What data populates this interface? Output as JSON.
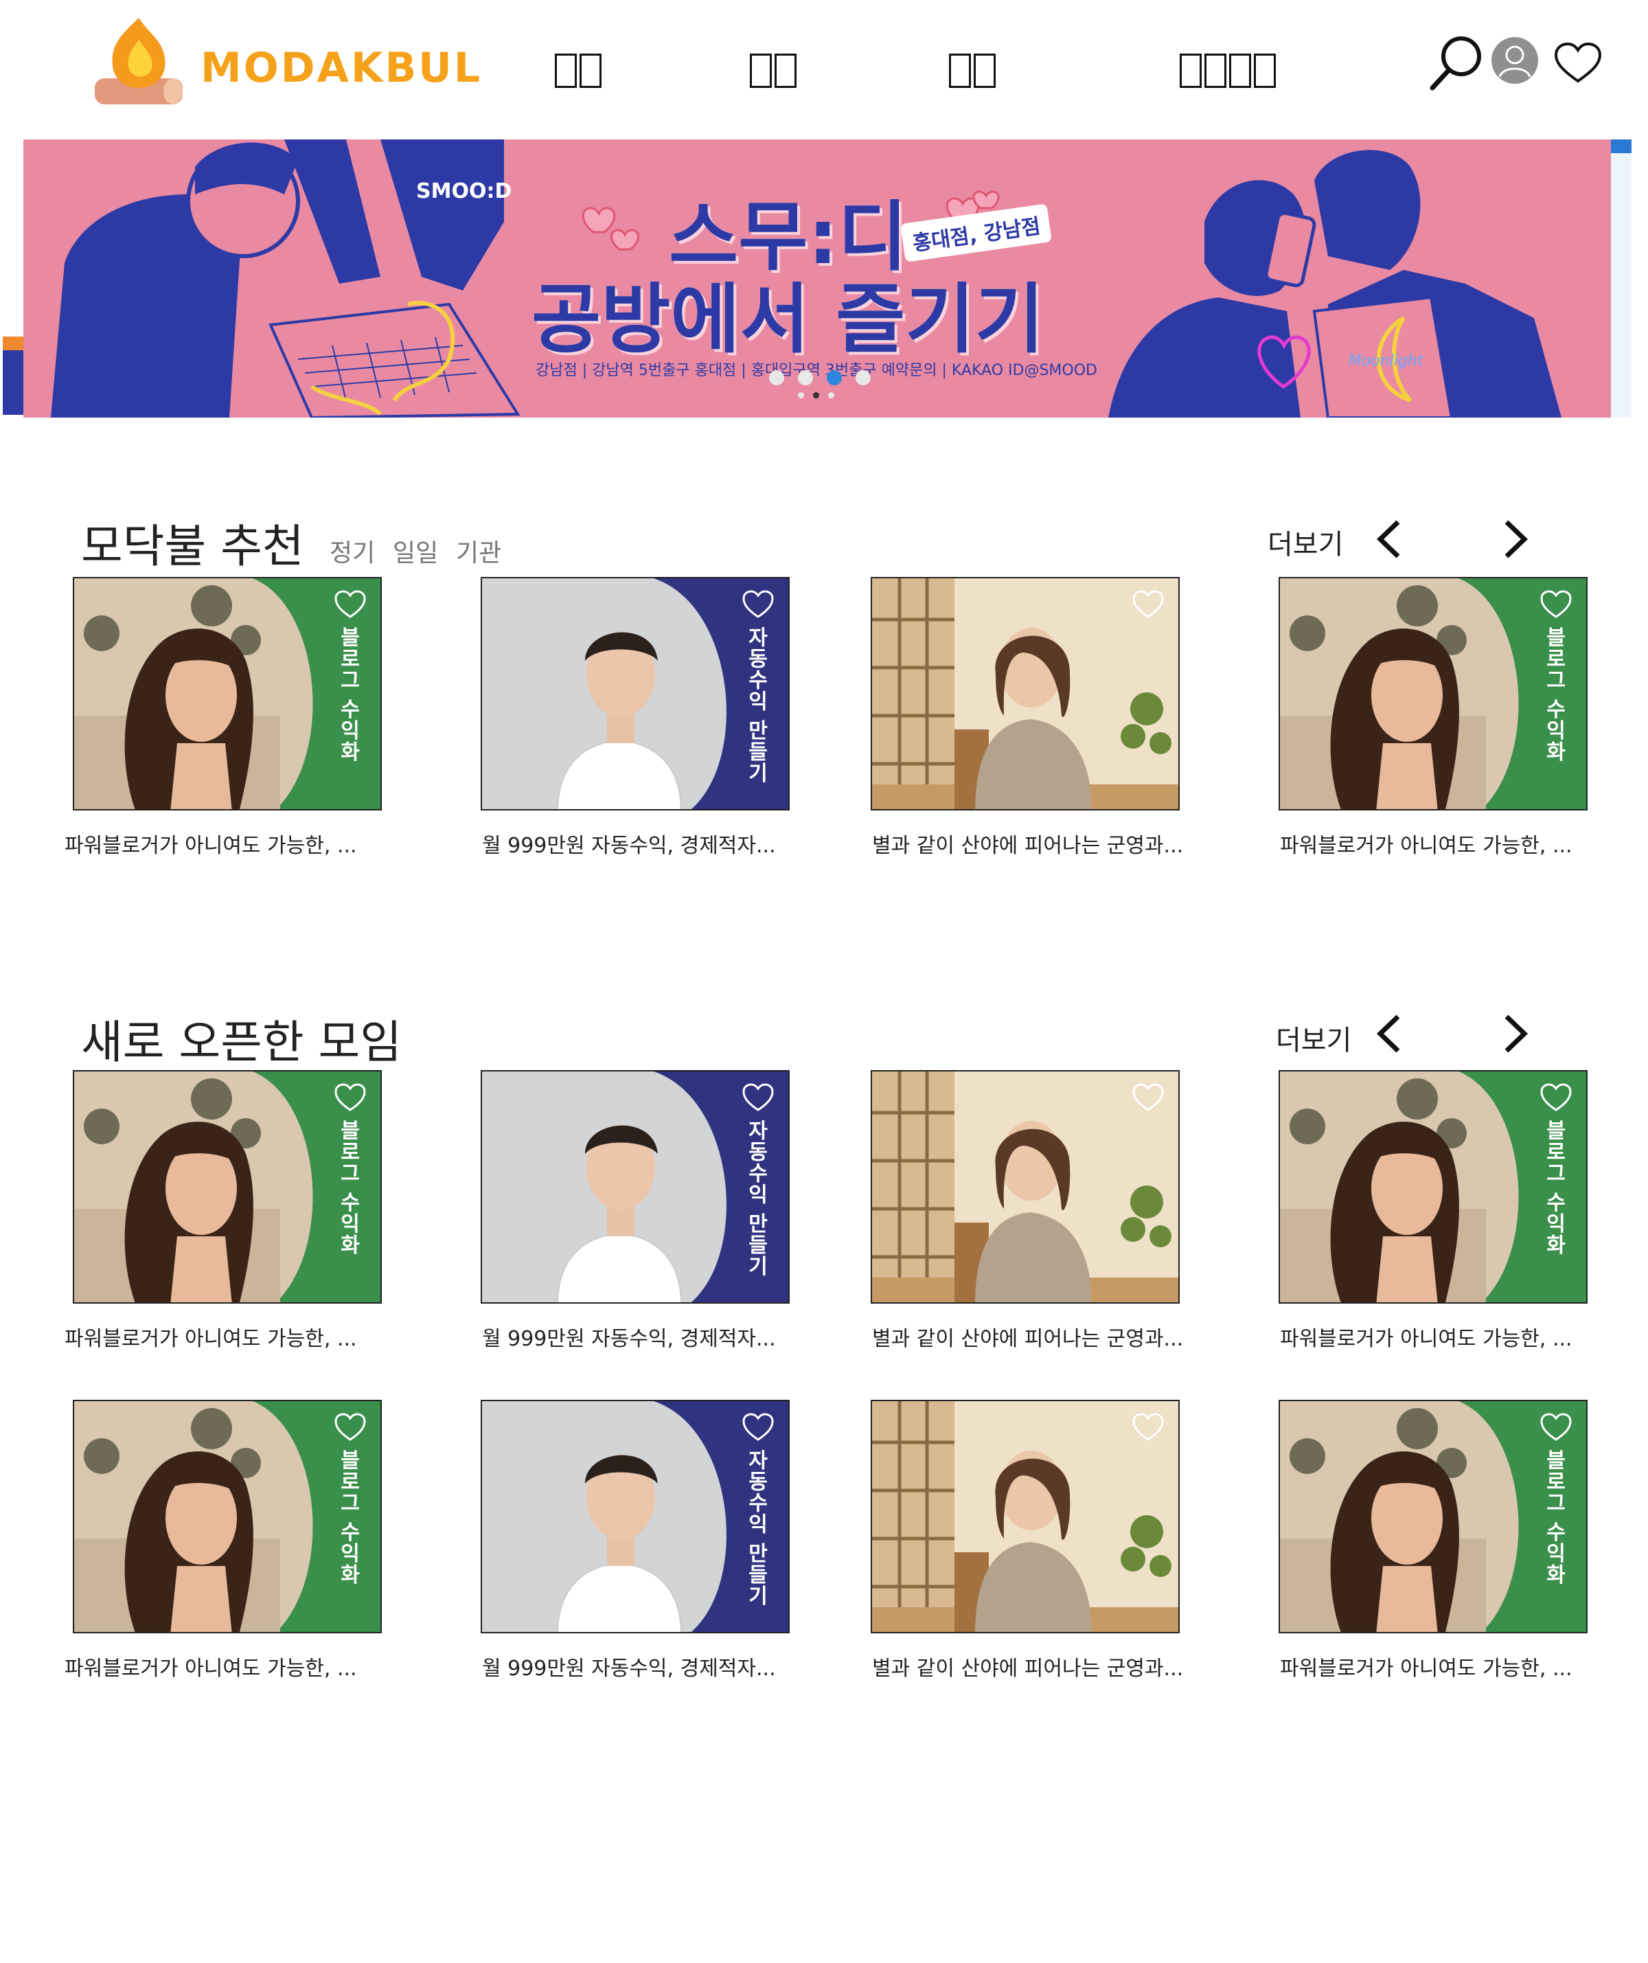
{
  "header": {
    "logo_text": "MODAKBUL",
    "nav": [
      "모임",
      "클래스",
      "커뮤",
      "마이페이지"
    ],
    "icons": [
      "search-icon",
      "user-avatar-icon",
      "heart-icon"
    ]
  },
  "banner": {
    "brand": "SMOO:D",
    "title_line1": "스무:디",
    "title_line2": "공방에서 즐기기",
    "tag": "홍대점, 강남점",
    "info": "강남점 | 강남역 5번출구   홍대점 | 홍대입구역 3번출구   예약문의 | KAKAO ID@SMOOD",
    "caption_script": "Moonlight",
    "dots": 4,
    "active_dot": 3,
    "colors": {
      "pink": "#e98aa2",
      "navy": "#2d3aa6",
      "accent": "#2e86de"
    }
  },
  "recommend": {
    "title": "모닥불 추천",
    "filters": [
      "정기",
      "일일",
      "기관"
    ],
    "more": "더보기"
  },
  "new_open": {
    "title": "새로 오픈한 모임",
    "more": "더보기"
  },
  "card_types": {
    "green": {
      "label": "블로그 수익화",
      "caption": "파워블로거가 아니여도 가능한, ...",
      "color": "#3a8f4a"
    },
    "navy": {
      "label": "자동수익 만들기",
      "caption": "월 999만원 자동수익, 경제적자...",
      "color": "#2f3380"
    },
    "cafe": {
      "label": "",
      "caption": "별과 같이 산야에 피어나는 군영과...",
      "color": "#c9a27a"
    }
  }
}
